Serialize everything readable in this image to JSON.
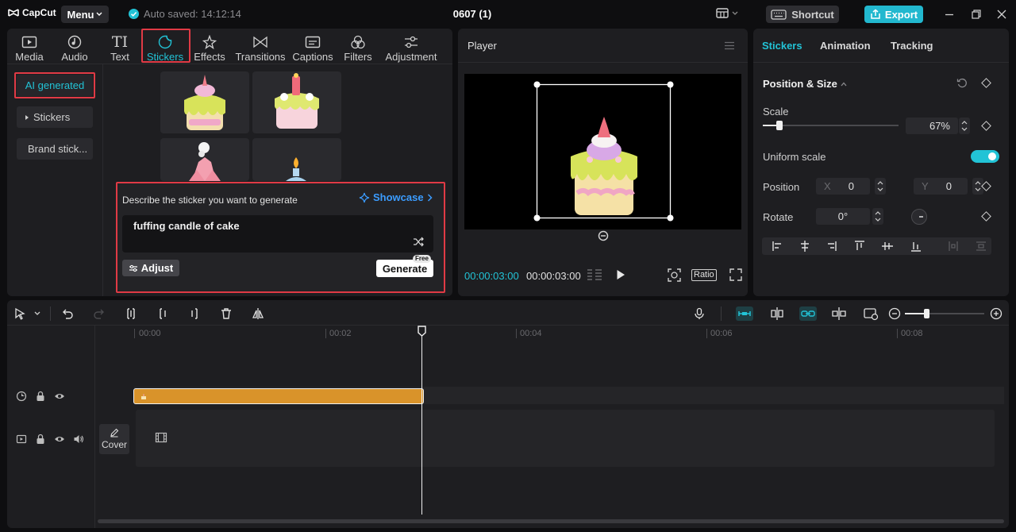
{
  "app": {
    "name": "CapCut",
    "menu_label": "Menu",
    "autosave_text": "Auto saved: 14:12:14",
    "project_title": "0607 (1)",
    "shortcut_label": "Shortcut",
    "export_label": "Export"
  },
  "categories": [
    {
      "label": "Media",
      "icon": "media-icon"
    },
    {
      "label": "Audio",
      "icon": "audio-icon"
    },
    {
      "label": "Text",
      "icon": "text-icon"
    },
    {
      "label": "Stickers",
      "icon": "stickers-icon"
    },
    {
      "label": "Effects",
      "icon": "effects-icon"
    },
    {
      "label": "Transitions",
      "icon": "transitions-icon"
    },
    {
      "label": "Captions",
      "icon": "captions-icon"
    },
    {
      "label": "Filters",
      "icon": "filters-icon"
    },
    {
      "label": "Adjustment",
      "icon": "adjustment-icon"
    }
  ],
  "sidebar": {
    "items": [
      {
        "label": "AI generated"
      },
      {
        "label": "Stickers"
      },
      {
        "label": "Brand stick..."
      }
    ]
  },
  "generator": {
    "describe_label": "Describe the sticker you want to generate",
    "showcase_label": "Showcase",
    "prompt_value": "fuffing candle of cake",
    "adjust_label": "Adjust",
    "generate_label": "Generate",
    "free_badge": "Free"
  },
  "player": {
    "title": "Player",
    "current_time": "00:00:03:00",
    "total_time": "00:00:03:00",
    "ratio_label": "Ratio"
  },
  "properties": {
    "tabs": [
      {
        "label": "Stickers"
      },
      {
        "label": "Animation"
      },
      {
        "label": "Tracking"
      }
    ],
    "section_title": "Position & Size",
    "scale_label": "Scale",
    "scale_value": "67%",
    "scale_fraction": 0.12,
    "uniform_scale_label": "Uniform scale",
    "uniform_scale_on": true,
    "position_label": "Position",
    "x_label": "X",
    "x_value": "0",
    "y_label": "Y",
    "y_value": "0",
    "rotate_label": "Rotate",
    "rotate_value": "0°"
  },
  "timeline": {
    "ruler": [
      "00:00",
      "00:02",
      "00:04",
      "00:06",
      "00:08"
    ],
    "cover_label": "Cover"
  },
  "colors": {
    "accent": "#22c3d6",
    "highlight_box": "#e03a45",
    "sticker_clip": "#d9932a",
    "export": "#22b8cf"
  }
}
